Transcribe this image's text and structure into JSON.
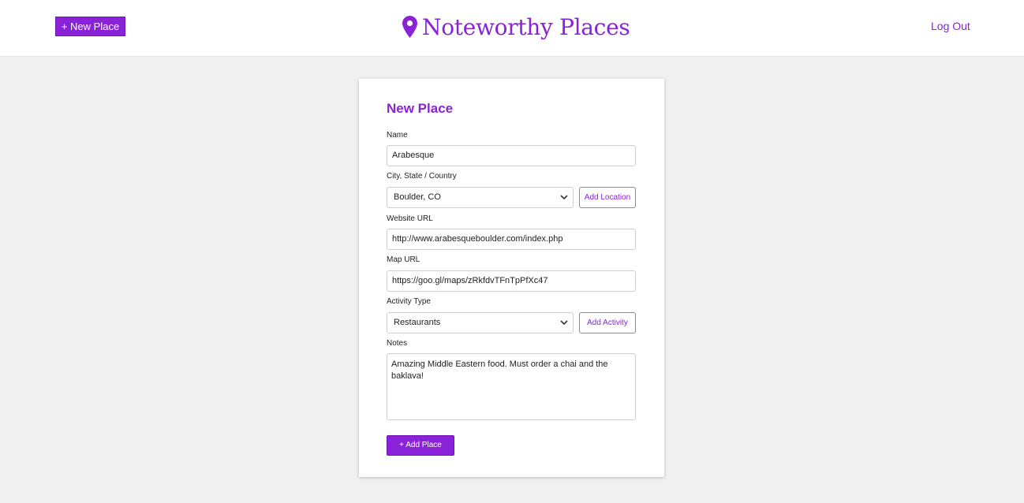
{
  "header": {
    "new_place_button": "+ New Place",
    "brand_title": "Noteworthy Places",
    "brand_icon": "map-pin-icon",
    "logout_link": "Log Out"
  },
  "form": {
    "title": "New Place",
    "name_label": "Name",
    "name_value": "Arabesque",
    "location_label": "City, State / Country",
    "location_selected": "Boulder, CO",
    "add_location_button": "Add Location",
    "website_label": "Website URL",
    "website_value": "http://www.arabesqueboulder.com/index.php",
    "map_label": "Map URL",
    "map_value": "https://goo.gl/maps/zRkfdvTFnTpPfXc47",
    "activity_label": "Activity Type",
    "activity_selected": "Restaurants",
    "add_activity_button": "Add Activity",
    "notes_label": "Notes",
    "notes_value": "Amazing Middle Eastern food. Must order a chai and the baklava!",
    "submit_button": "+ Add Place"
  },
  "colors": {
    "accent": "#8a22d8",
    "background": "#f0f0f0",
    "card": "#ffffff"
  }
}
